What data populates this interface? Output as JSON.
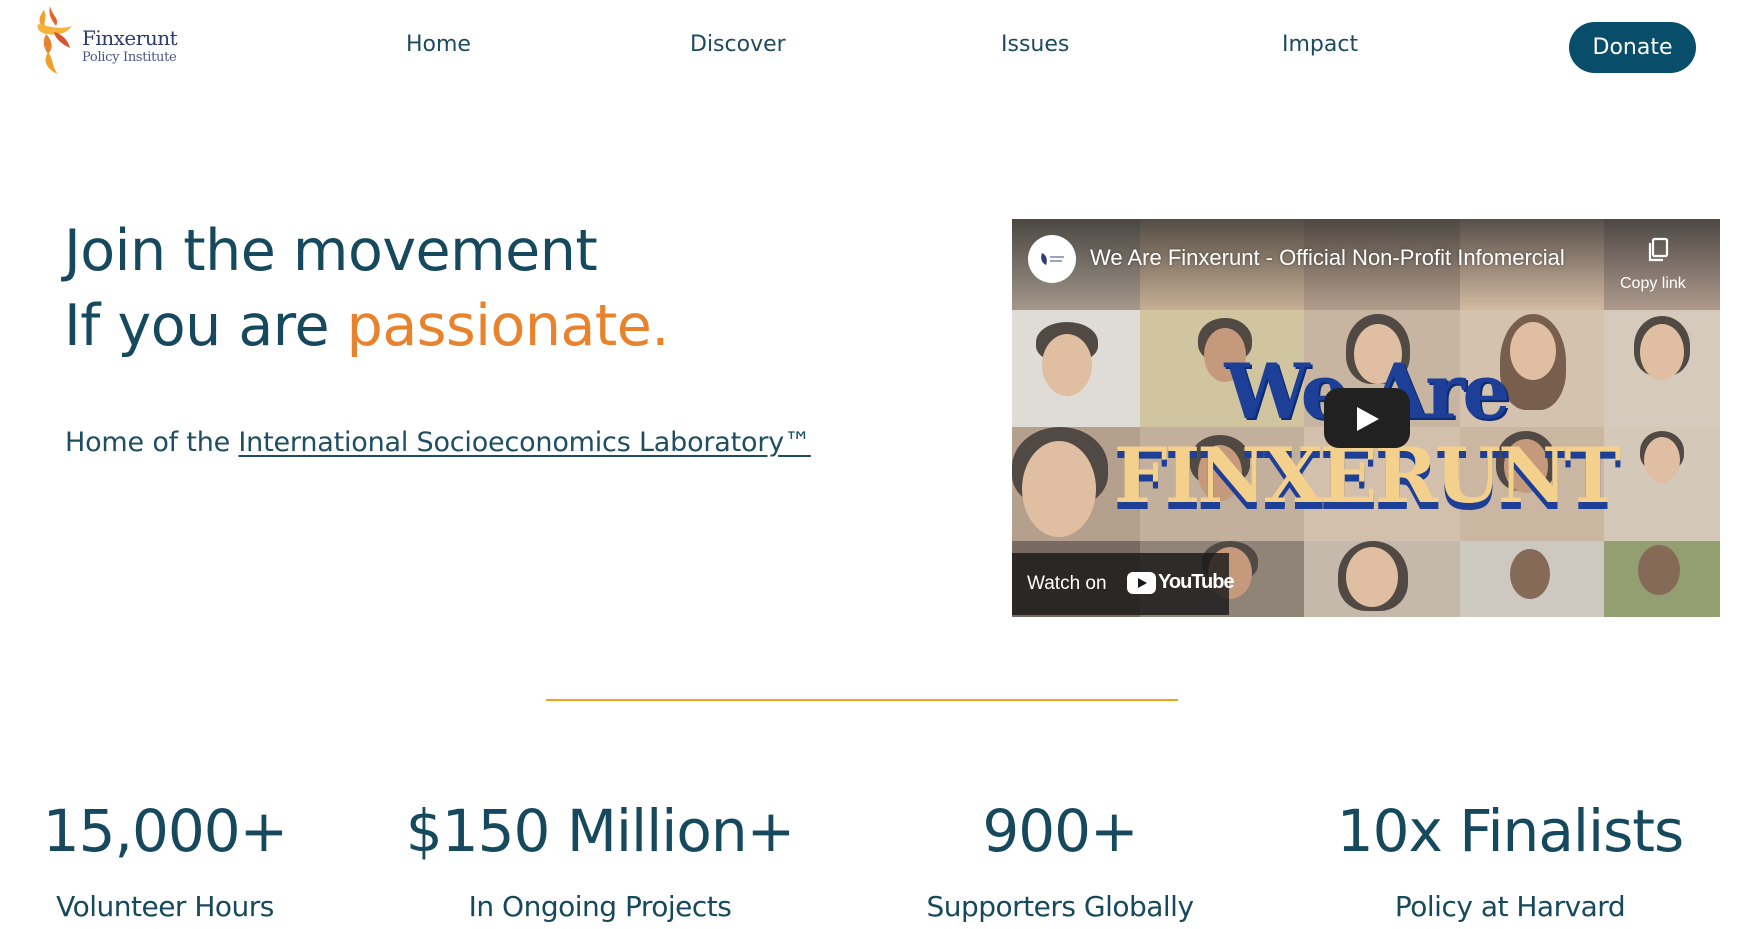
{
  "header": {
    "logo_name": "Finxerunt",
    "logo_sub": "Policy Institute",
    "nav": [
      "Home",
      "Discover",
      "Issues",
      "Impact"
    ],
    "donate_label": "Donate"
  },
  "hero": {
    "line1": "Join the movement",
    "line2_prefix": "If you are ",
    "line2_accent": "passionate.",
    "home_of_prefix": "Home of the ",
    "lab_link": "International Socioeconomics Laboratory™"
  },
  "video": {
    "title": "We Are Finxerunt - Official Non-Profit Infomercial",
    "copy_label": "Copy link",
    "thumb_we_are": "We Are",
    "thumb_finxerunt": "FINXERUNT",
    "watch_on": "Watch on",
    "youtube": "YouTube"
  },
  "stats": [
    {
      "value": "15,000+",
      "label": "Volunteer Hours"
    },
    {
      "value": "$150 Million+",
      "label": "In Ongoing Projects"
    },
    {
      "value": "900+",
      "label": "Supporters Globally"
    },
    {
      "value": "10x Finalists",
      "label": "Policy at Harvard"
    }
  ],
  "colors": {
    "brand_dark": "#084d6a",
    "text": "#16495e",
    "accent": "#e8822c",
    "divider": "#f2a31b"
  }
}
